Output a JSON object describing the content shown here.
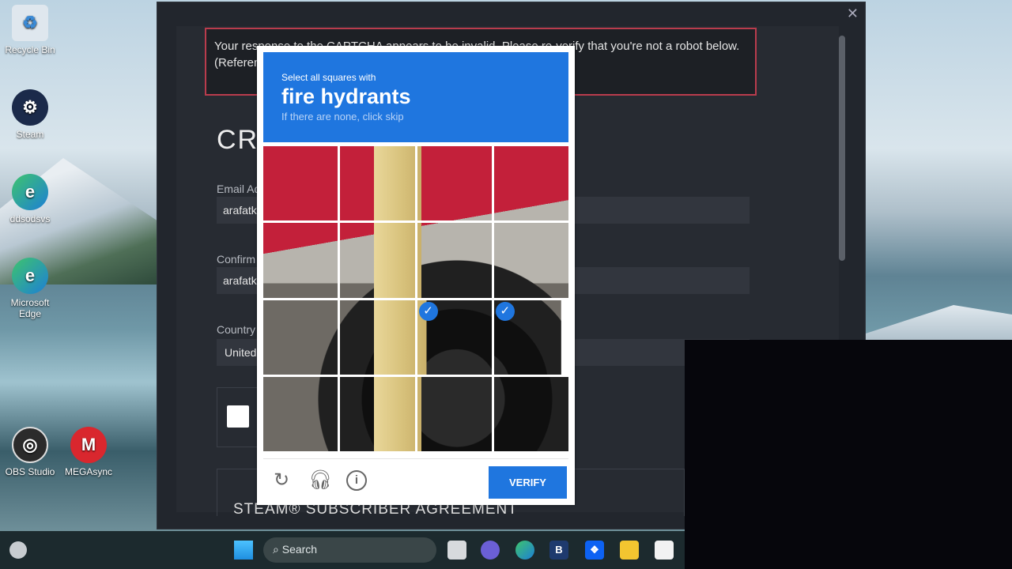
{
  "desktop": {
    "icons": [
      {
        "label": "Recycle Bin",
        "icon": "recycle-bin-icon"
      },
      {
        "label": "Steam",
        "icon": "steam-icon"
      },
      {
        "label": "ddsodsvs",
        "icon": "edge-icon"
      },
      {
        "label": "Microsoft Edge",
        "icon": "edge-icon"
      },
      {
        "label": "OBS Studio",
        "icon": "obs-icon"
      },
      {
        "label": "MEGAsync",
        "icon": "mega-icon"
      }
    ]
  },
  "dialog": {
    "close": "✕",
    "error": "Your response to the CAPTCHA appears to be invalid. Please re-verify that you're not a robot below.",
    "error_ref": "(Referen",
    "title": "CRE",
    "email_label": "Email Ad",
    "email_value": "arafatki",
    "confirm_label": "Confirm",
    "confirm_value": "arafatki",
    "country_label": "Country",
    "country_value": "United",
    "agreement": "STEAM® SUBSCRIBER AGREEMENT"
  },
  "captcha": {
    "instruction": "Select all squares with",
    "target": "fire hydrants",
    "hint": "If there are none, click skip",
    "selected_tiles": [
      10,
      11
    ],
    "verify": "VERIFY",
    "accent": "#1f76df",
    "icons": [
      "refresh-icon",
      "headphones-icon",
      "info-icon"
    ]
  },
  "taskbar": {
    "search": "Search",
    "apps": [
      "task-view-icon",
      "teams-icon",
      "edge-icon",
      "b-app-icon",
      "dropbox-icon",
      "file-explorer-icon",
      "store-icon"
    ]
  }
}
